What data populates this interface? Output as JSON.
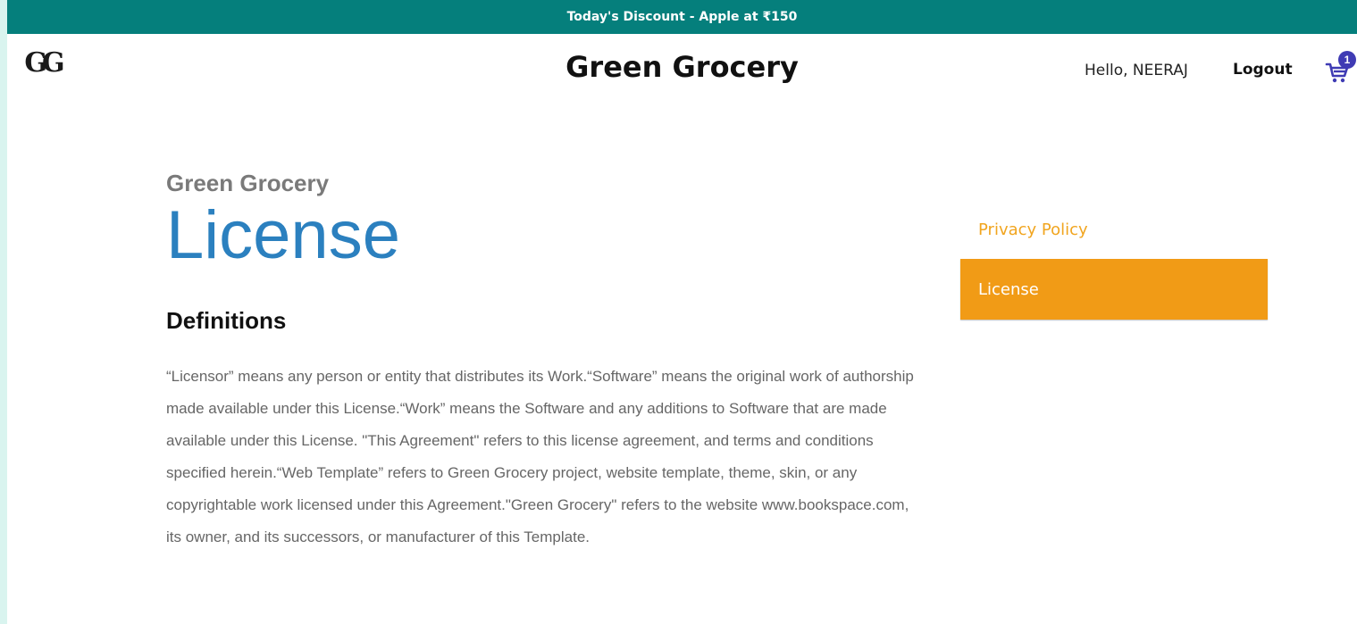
{
  "promo": {
    "text": "Today's Discount - Apple at ₹150"
  },
  "header": {
    "logo_text": "GG",
    "site_title": "Green Grocery",
    "greeting": "Hello, NEERAJ",
    "logout_label": "Logout",
    "cart_count": "1",
    "cart_icon": "cart-icon"
  },
  "content": {
    "eyebrow": "Green Grocery",
    "title": "License",
    "section_heading": "Definitions",
    "body": "“Licensor” means any person or entity that distributes its Work.“Software” means the original work of authorship made available under this License.“Work” means the Software and any additions to Software that are made available under this License. \"This Agreement\" refers to this license agreement, and terms and conditions specified herein.“Web Template” refers to Green Grocery project, website template, theme, skin, or any copyrightable work licensed under this Agreement.\"Green Grocery\" refers to the website www.bookspace.com, its owner, and its successors, or manufacturer of this Template."
  },
  "side_nav": {
    "items": [
      {
        "label": "Privacy Policy",
        "active": false
      },
      {
        "label": "License",
        "active": true
      }
    ]
  },
  "colors": {
    "promo_bg": "#057f7c",
    "title_blue": "#2b80bf",
    "accent_orange": "#f19b16",
    "cart_purple": "#3f3bb4"
  }
}
